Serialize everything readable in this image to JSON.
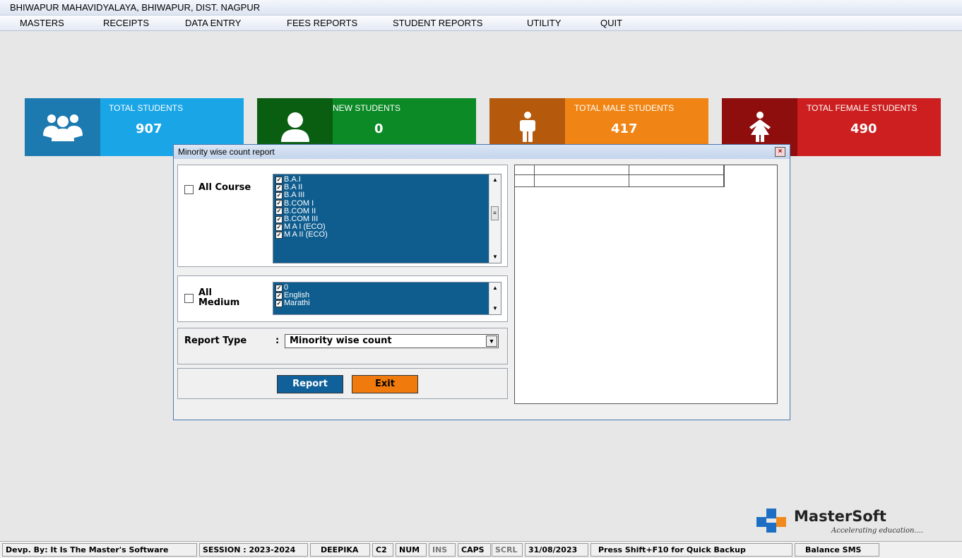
{
  "window": {
    "title": "BHIWAPUR MAHAVIDYALAYA, BHIWAPUR, DIST. NAGPUR"
  },
  "menu": [
    "MASTERS",
    "RECEIPTS",
    "DATA ENTRY",
    "FEES REPORTS",
    "STUDENT REPORTS",
    "UTILITY",
    "QUIT"
  ],
  "tiles": [
    {
      "label": "TOTAL STUDENTS",
      "value": "907",
      "icon": "group-icon",
      "dark": "#1d7ab0",
      "light": "#19a5e6"
    },
    {
      "label": "NEW STUDENTS",
      "value": "0",
      "icon": "user-icon",
      "dark": "#0a5e12",
      "light": "#0b8a25"
    },
    {
      "label": "TOTAL MALE STUDENTS",
      "value": "417",
      "icon": "male-icon",
      "dark": "#b55a0d",
      "light": "#f08515"
    },
    {
      "label": "TOTAL FEMALE STUDENTS",
      "value": "490",
      "icon": "female-icon",
      "dark": "#8e0e0e",
      "light": "#cd1f1f"
    }
  ],
  "dialog": {
    "title": "Minority wise count report",
    "all_course_label": "All Course",
    "courses": [
      "B.A.I",
      "B.A II",
      "B.A III",
      "B.COM I",
      "B.COM II",
      "B.COM III",
      "M A I (ECO)",
      "M A II (ECO)"
    ],
    "all_medium_label_1": "All",
    "all_medium_label_2": "Medium",
    "mediums": [
      "0",
      "English",
      "Marathi"
    ],
    "report_type_label": "Report Type",
    "report_type_sep": ":",
    "report_type_value": "Minority wise count",
    "report_button_label": "Report",
    "exit_button_label": "Exit"
  },
  "logo": {
    "name": "MasterSoft",
    "tagline": "Accelerating education...."
  },
  "status": [
    "Devp. By: It Is The Master's Software",
    "SESSION : 2023-2024",
    "DEEPIKA",
    "C2",
    "NUM",
    "INS",
    "CAPS",
    "SCRL",
    "31/08/2023",
    "Press Shift+F10 for Quick Backup",
    "Balance SMS"
  ],
  "colors": {
    "list_bg": "#0f5d8f",
    "report_button": "#10609a",
    "exit_button": "#f07a0c"
  }
}
